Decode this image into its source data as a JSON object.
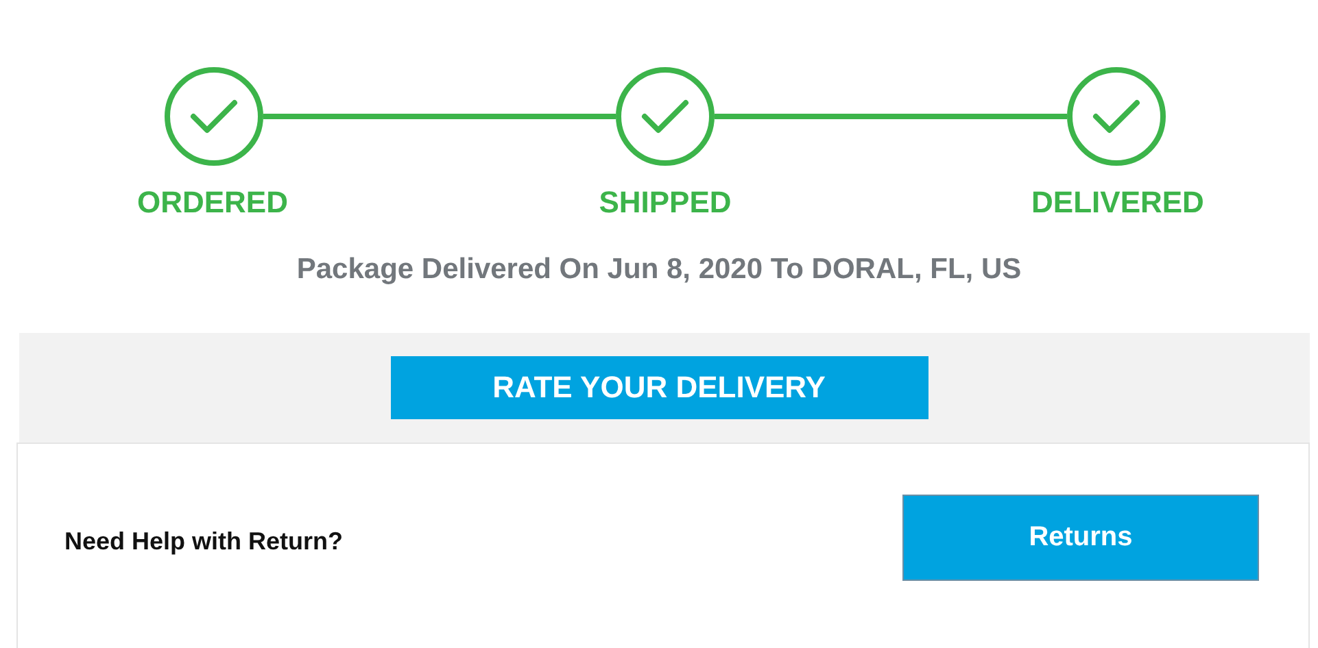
{
  "progress": {
    "steps": [
      {
        "label": "ORDERED",
        "completed": true
      },
      {
        "label": "SHIPPED",
        "completed": true
      },
      {
        "label": "DELIVERED",
        "completed": true
      }
    ]
  },
  "status": "Package Delivered On Jun 8, 2020 To DORAL, FL, US",
  "rate_button": "RATE YOUR DELIVERY",
  "help": {
    "question": "Need Help with Return?",
    "button": "Returns"
  }
}
